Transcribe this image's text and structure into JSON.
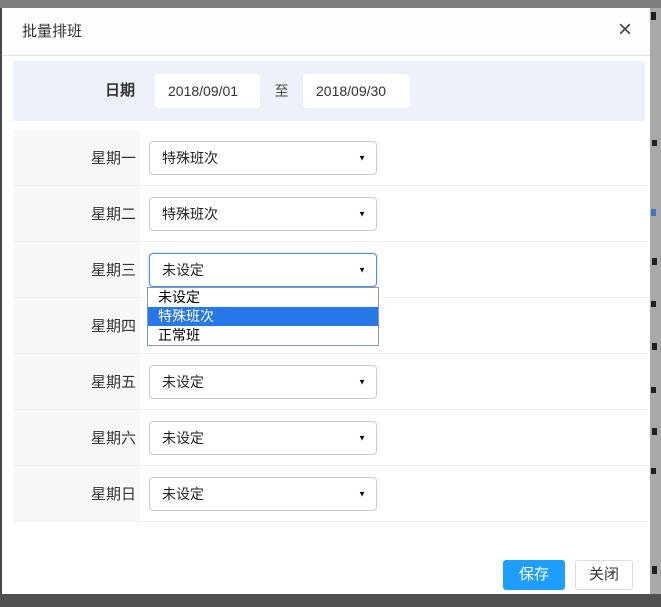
{
  "window": {
    "title": "批量排班",
    "icons": {
      "close": "×",
      "caret_down": "▼"
    }
  },
  "date_section": {
    "label": "日期",
    "start_value": "2018/09/01",
    "separator": "至",
    "end_value": "2018/09/30"
  },
  "rows": [
    {
      "day": "星期一",
      "value": "特殊班次"
    },
    {
      "day": "星期二",
      "value": "特殊班次"
    },
    {
      "day": "星期三",
      "value": "未设定"
    },
    {
      "day": "星期四",
      "value": ""
    },
    {
      "day": "星期五",
      "value": "未设定"
    },
    {
      "day": "星期六",
      "value": "未设定"
    },
    {
      "day": "星期日",
      "value": "未设定"
    }
  ],
  "dropdown_open": {
    "owner_day": "星期三",
    "options": [
      {
        "label": "未设定",
        "highlighted": false
      },
      {
        "label": "特殊班次",
        "highlighted": true
      },
      {
        "label": "正常班",
        "highlighted": false
      }
    ]
  },
  "footer": {
    "save": "保存",
    "close": "关闭"
  },
  "colors": {
    "accent_blue": "#1e9fff",
    "highlight_blue": "#2777e8",
    "focus_border": "#4a90e2",
    "date_band_bg": "#edf1f9",
    "label_cell_bg": "#f8f8f8"
  }
}
